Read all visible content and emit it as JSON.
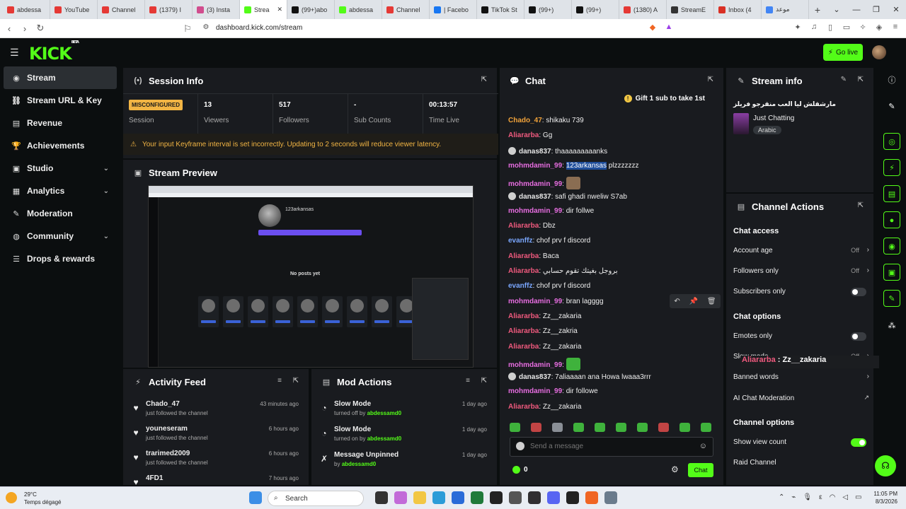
{
  "browser": {
    "tabs": [
      {
        "label": "abdessa",
        "color": "#e53935"
      },
      {
        "label": "YouTube",
        "color": "#e53935"
      },
      {
        "label": "Channel",
        "color": "#e53935"
      },
      {
        "label": "(1379) I",
        "color": "#e53935"
      },
      {
        "label": "(3) Insta",
        "color": "#d14d8e"
      },
      {
        "label": "Strea",
        "color": "#53fc18"
      },
      {
        "label": "(99+)abo",
        "color": "#111111"
      },
      {
        "label": "abdessa",
        "color": "#53fc18"
      },
      {
        "label": "Channel",
        "color": "#e53935"
      },
      {
        "label": "| Facebo",
        "color": "#1877f2"
      },
      {
        "label": "TikTok St",
        "color": "#111111"
      },
      {
        "label": "(99+)",
        "color": "#111111"
      },
      {
        "label": "(99+)",
        "color": "#111111"
      },
      {
        "label": "(1380) A",
        "color": "#e53935"
      },
      {
        "label": "StreamE",
        "color": "#333333"
      },
      {
        "label": "Inbox (4",
        "color": "#d93025"
      },
      {
        "label": "موعد",
        "color": "#4285f4"
      }
    ],
    "url": "dashboard.kick.com/stream"
  },
  "header": {
    "logo": "KICK",
    "logo_badge": "BETA",
    "go_live": "Go live"
  },
  "sidebar": {
    "items": [
      {
        "label": "Stream",
        "icon": "stream-icon",
        "glyph": "◉"
      },
      {
        "label": "Stream URL & Key",
        "icon": "link-icon",
        "glyph": "⛓"
      },
      {
        "label": "Revenue",
        "icon": "revenue-icon",
        "glyph": "▤"
      },
      {
        "label": "Achievements",
        "icon": "trophy-icon",
        "glyph": "🏆"
      },
      {
        "label": "Studio",
        "icon": "studio-icon",
        "glyph": "▣"
      },
      {
        "label": "Analytics",
        "icon": "analytics-icon",
        "glyph": "▦"
      },
      {
        "label": "Moderation",
        "icon": "wrench-icon",
        "glyph": "✎"
      },
      {
        "label": "Community",
        "icon": "community-icon",
        "glyph": "◍"
      },
      {
        "label": "Drops & rewards",
        "icon": "drops-icon",
        "glyph": "☰"
      }
    ]
  },
  "session": {
    "title": "Session Info",
    "badge": "MISCONFIGURED",
    "stats": [
      {
        "value": "",
        "label": "Session"
      },
      {
        "value": "13",
        "label": "Viewers"
      },
      {
        "value": "517",
        "label": "Followers"
      },
      {
        "value": "-",
        "label": "Sub Counts"
      },
      {
        "value": "00:13:57",
        "label": "Time Live"
      }
    ],
    "warning": "Your input Keyframe interval is set incorrectly. Updating to 2 seconds will reduce viewer latency."
  },
  "preview": {
    "title": "Stream Preview",
    "channel": "123arkansas",
    "no_posts": "No posts yet"
  },
  "activity": {
    "title": "Activity Feed",
    "items": [
      {
        "name": "Chado_47",
        "sub": "just followed the channel",
        "time": "43 minutes ago"
      },
      {
        "name": "youneseram",
        "sub": "just followed the channel",
        "time": "6 hours ago"
      },
      {
        "name": "trarimed2009",
        "sub": "just followed the channel",
        "time": "6 hours ago"
      },
      {
        "name": "4FD1",
        "sub": "",
        "time": "7 hours ago"
      }
    ]
  },
  "mod": {
    "title": "Mod Actions",
    "items": [
      {
        "name": "Slow Mode",
        "prefix": "turned off by",
        "user": "abdessamd0",
        "time": "1 day ago"
      },
      {
        "name": "Slow Mode",
        "prefix": "turned on by",
        "user": "abdessamd0",
        "time": "1 day ago"
      },
      {
        "name": "Message Unpinned",
        "prefix": "by",
        "user": "abdessamd0",
        "time": "1 day ago"
      }
    ]
  },
  "chat": {
    "title": "Chat",
    "gift": "Gift 1 sub to take 1st",
    "messages": [
      {
        "user": "Chado_47",
        "color": "#f2a33a",
        "text": "shikaku 739",
        "mod": false
      },
      {
        "user": "Aliararba",
        "color": "#f05a7e",
        "text": "Gg",
        "mod": false
      },
      {
        "user": "danas837",
        "color": "#e8e8e8",
        "text": "thaaaaaaaaanks",
        "mod": true
      },
      {
        "user": "mohmdamin_99",
        "color": "#e66de0",
        "text": "plzzzzzzz",
        "highlight": "123arkansas",
        "mod": false
      },
      {
        "user": "mohmdamin_99",
        "color": "#e66de0",
        "text": "",
        "emote": true,
        "mod": false
      },
      {
        "user": "danas837",
        "color": "#e8e8e8",
        "text": "safi ghadi nweliw S7ab",
        "mod": true
      },
      {
        "user": "mohmdamin_99",
        "color": "#e66de0",
        "text": "dir follwe",
        "mod": false
      },
      {
        "user": "Aliararba",
        "color": "#f05a7e",
        "text": "Dbz",
        "mod": false
      },
      {
        "user": "evanffz",
        "color": "#7aa7ff",
        "text": "chof prv f discord",
        "mod": false
      },
      {
        "user": "Aliararba",
        "color": "#f05a7e",
        "text": "Baca",
        "mod": false
      },
      {
        "user": "Aliararba",
        "color": "#f05a7e",
        "text": "بروجل بغيتك تقوم حسابي",
        "mod": false
      },
      {
        "user": "evanffz",
        "color": "#7aa7ff",
        "text": "chof prv f discord",
        "mod": false
      },
      {
        "user": "mohmdamin_99",
        "color": "#e66de0",
        "text": "bran lagggg",
        "mod": false
      },
      {
        "user": "Aliararba",
        "color": "#f05a7e",
        "text": "Zz__zakaria",
        "mod": false
      },
      {
        "user": "Aliararba",
        "color": "#f05a7e",
        "text": "Zz__zakria",
        "mod": false
      },
      {
        "user": "Aliararba",
        "color": "#f05a7e",
        "text": "Zz__zakaria",
        "mod": false
      },
      {
        "user": "mohmdamin_99",
        "color": "#e66de0",
        "text": "",
        "emote": true,
        "mod": false
      },
      {
        "user": "danas837",
        "color": "#e8e8e8",
        "text": "7aliaaaan ana Howa lwaaa3rrr",
        "mod": true
      },
      {
        "user": "mohmdamin_99",
        "color": "#e66de0",
        "text": "dir followe",
        "mod": false
      },
      {
        "user": "Aliararba",
        "color": "#f05a7e",
        "text": "Zz__zakaria",
        "mod": false
      }
    ],
    "placeholder": "Send a message",
    "points": "0",
    "send": "Chat"
  },
  "stream_info": {
    "title": "Stream info",
    "stream_title": "مارشقلش ليا العب منقرجو فريلز",
    "category": "Just Chatting",
    "tag": "Arabic"
  },
  "channel_actions": {
    "title": "Channel Actions",
    "chat_access": "Chat access",
    "account_age": {
      "label": "Account age",
      "value": "Off"
    },
    "followers_only": {
      "label": "Followers only",
      "value": "Off"
    },
    "subscribers_only": "Subscribers only",
    "chat_options": "Chat options",
    "emotes_only": "Emotes only",
    "slow_mode": {
      "label": "Slow mode",
      "value": "Off"
    },
    "banned_words": "Banned words",
    "ai_moderation": "AI Chat Moderation",
    "channel_options": "Channel options",
    "show_view_count": "Show view count",
    "raid_channel": "Raid Channel"
  },
  "tooltip": {
    "user": "Aliararba",
    "text": "Zz__zakaria"
  },
  "taskbar": {
    "temp": "29°C",
    "weather": "Temps dégagé",
    "search": "Search",
    "time": "11:05 PM",
    "date": "8/3/2026"
  }
}
